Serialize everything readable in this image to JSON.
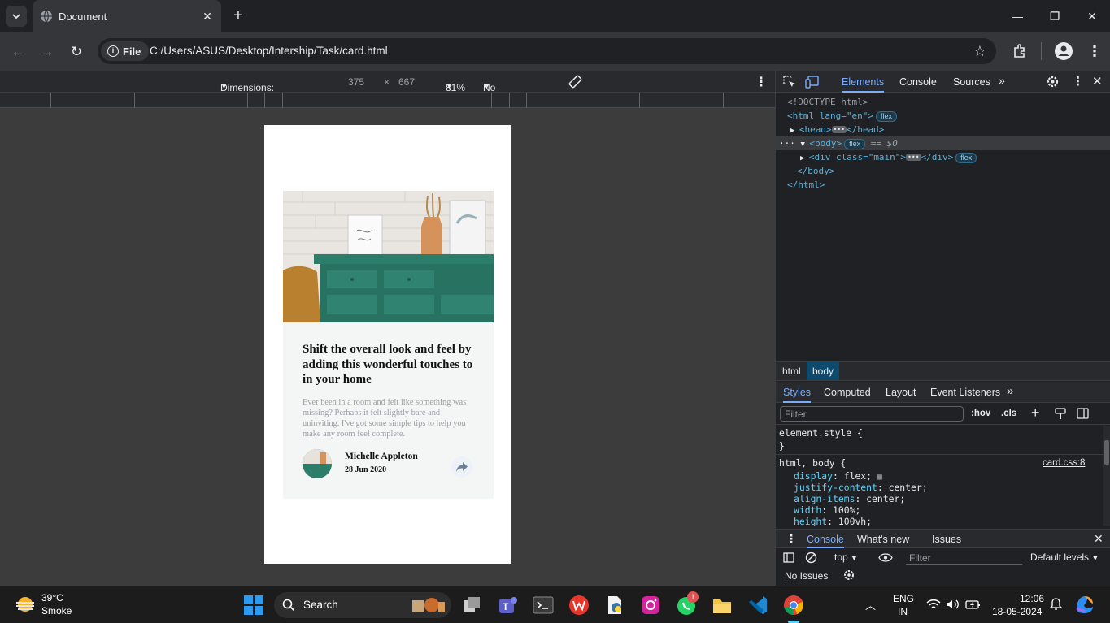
{
  "browser": {
    "tab_title": "Document",
    "tab_close": "✕",
    "new_tab": "+",
    "window_minimize": "—",
    "window_restore": "❐",
    "window_close": "✕",
    "chip_label": "File",
    "url": "C:/Users/ASUS/Desktop/Intership/Task/card.html"
  },
  "device_toolbar": {
    "dimensions_label": "Dimensions: iPhone SE",
    "width": "375",
    "times": "×",
    "height": "667",
    "zoom": "81%",
    "throttling": "No throttling"
  },
  "card": {
    "title": "Shift the overall look and feel by adding this wonderful touches to in your home",
    "description": "Ever been in a room and felt like something was missing? Perhaps it felt slightly bare and uninviting. I've got some simple tips to help you make any room feel complete.",
    "author": "Michelle Appleton",
    "date": "28 Jun 2020"
  },
  "devtools": {
    "tabs": [
      "Elements",
      "Console",
      "Sources"
    ],
    "dom": {
      "doctype": "<!DOCTYPE html>",
      "html_open": "<html lang=\"en\">",
      "head": "<head>",
      "head_close": "</head>",
      "body_open": "<body>",
      "selected_marker": "== $0",
      "div_open": "<div class=\"main\">",
      "div_close": "</div>",
      "body_close": "</body>",
      "html_close": "</html>",
      "badge": "flex"
    },
    "breadcrumbs": [
      "html",
      "body"
    ],
    "style_tabs": [
      "Styles",
      "Computed",
      "Layout",
      "Event Listeners"
    ],
    "filter_placeholder": "Filter",
    "hov": ":hov",
    "cls": ".cls",
    "element_style": "element.style {",
    "close_brace": "}",
    "rule_selector": "html, body {",
    "rule_source": "card.css:8",
    "declarations": [
      {
        "prop": "display",
        "value": "flex;"
      },
      {
        "prop": "justify-content",
        "value": "center;"
      },
      {
        "prop": "align-items",
        "value": "center;"
      },
      {
        "prop": "width",
        "value": "100%;"
      },
      {
        "prop": "height",
        "value": "100vh;"
      }
    ],
    "drawer_tabs": [
      "Console",
      "What's new",
      "Issues"
    ],
    "console_context": "top",
    "console_filter": "Filter",
    "default_levels": "Default levels",
    "no_issues": "No Issues"
  },
  "taskbar": {
    "temperature": "39°C",
    "weather": "Smoke",
    "search": "Search",
    "lang_1": "ENG",
    "lang_2": "IN",
    "time": "12:06",
    "date": "18-05-2024",
    "whatsapp_badge": "1"
  }
}
